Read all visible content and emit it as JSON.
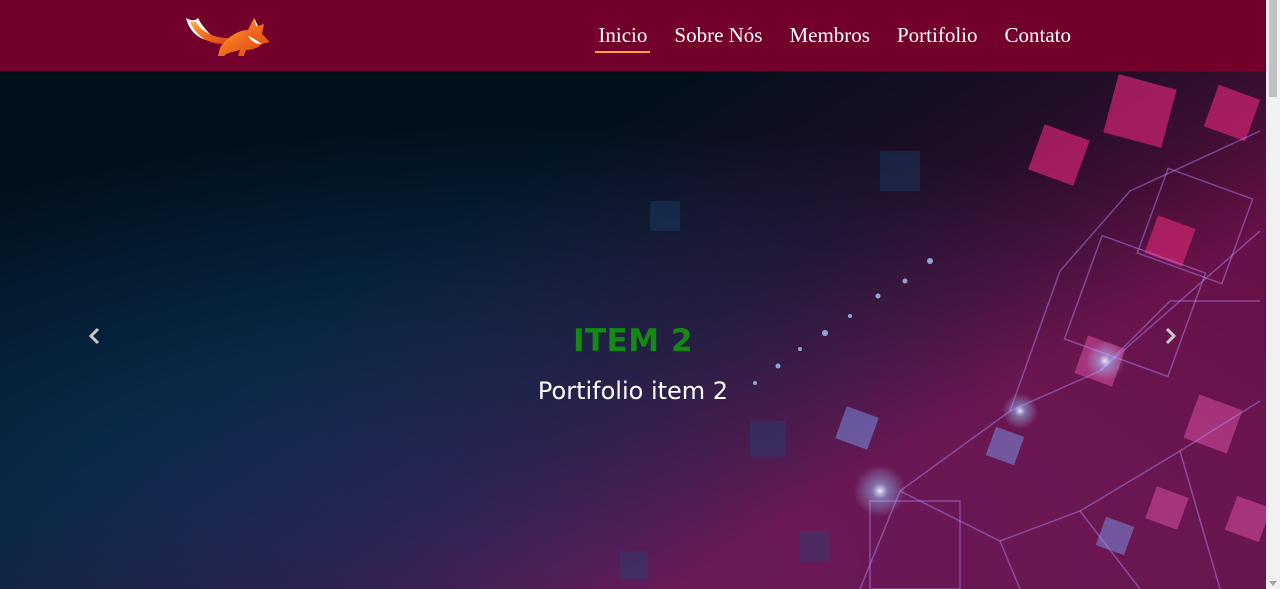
{
  "navbar": {
    "brand_color": "#72002a",
    "active_underline_color": "#f5a623",
    "links": [
      {
        "label": "Inicio",
        "active": true
      },
      {
        "label": "Sobre Nós",
        "active": false
      },
      {
        "label": "Membros",
        "active": false
      },
      {
        "label": "Portifolio",
        "active": false
      },
      {
        "label": "Contato",
        "active": false
      }
    ]
  },
  "carousel": {
    "prev_icon": "chevron-left-icon",
    "next_icon": "chevron-right-icon",
    "caption_title": "ITEM 2",
    "caption_title_color": "#138a12",
    "caption_subtitle": "Portifolio item 2"
  }
}
